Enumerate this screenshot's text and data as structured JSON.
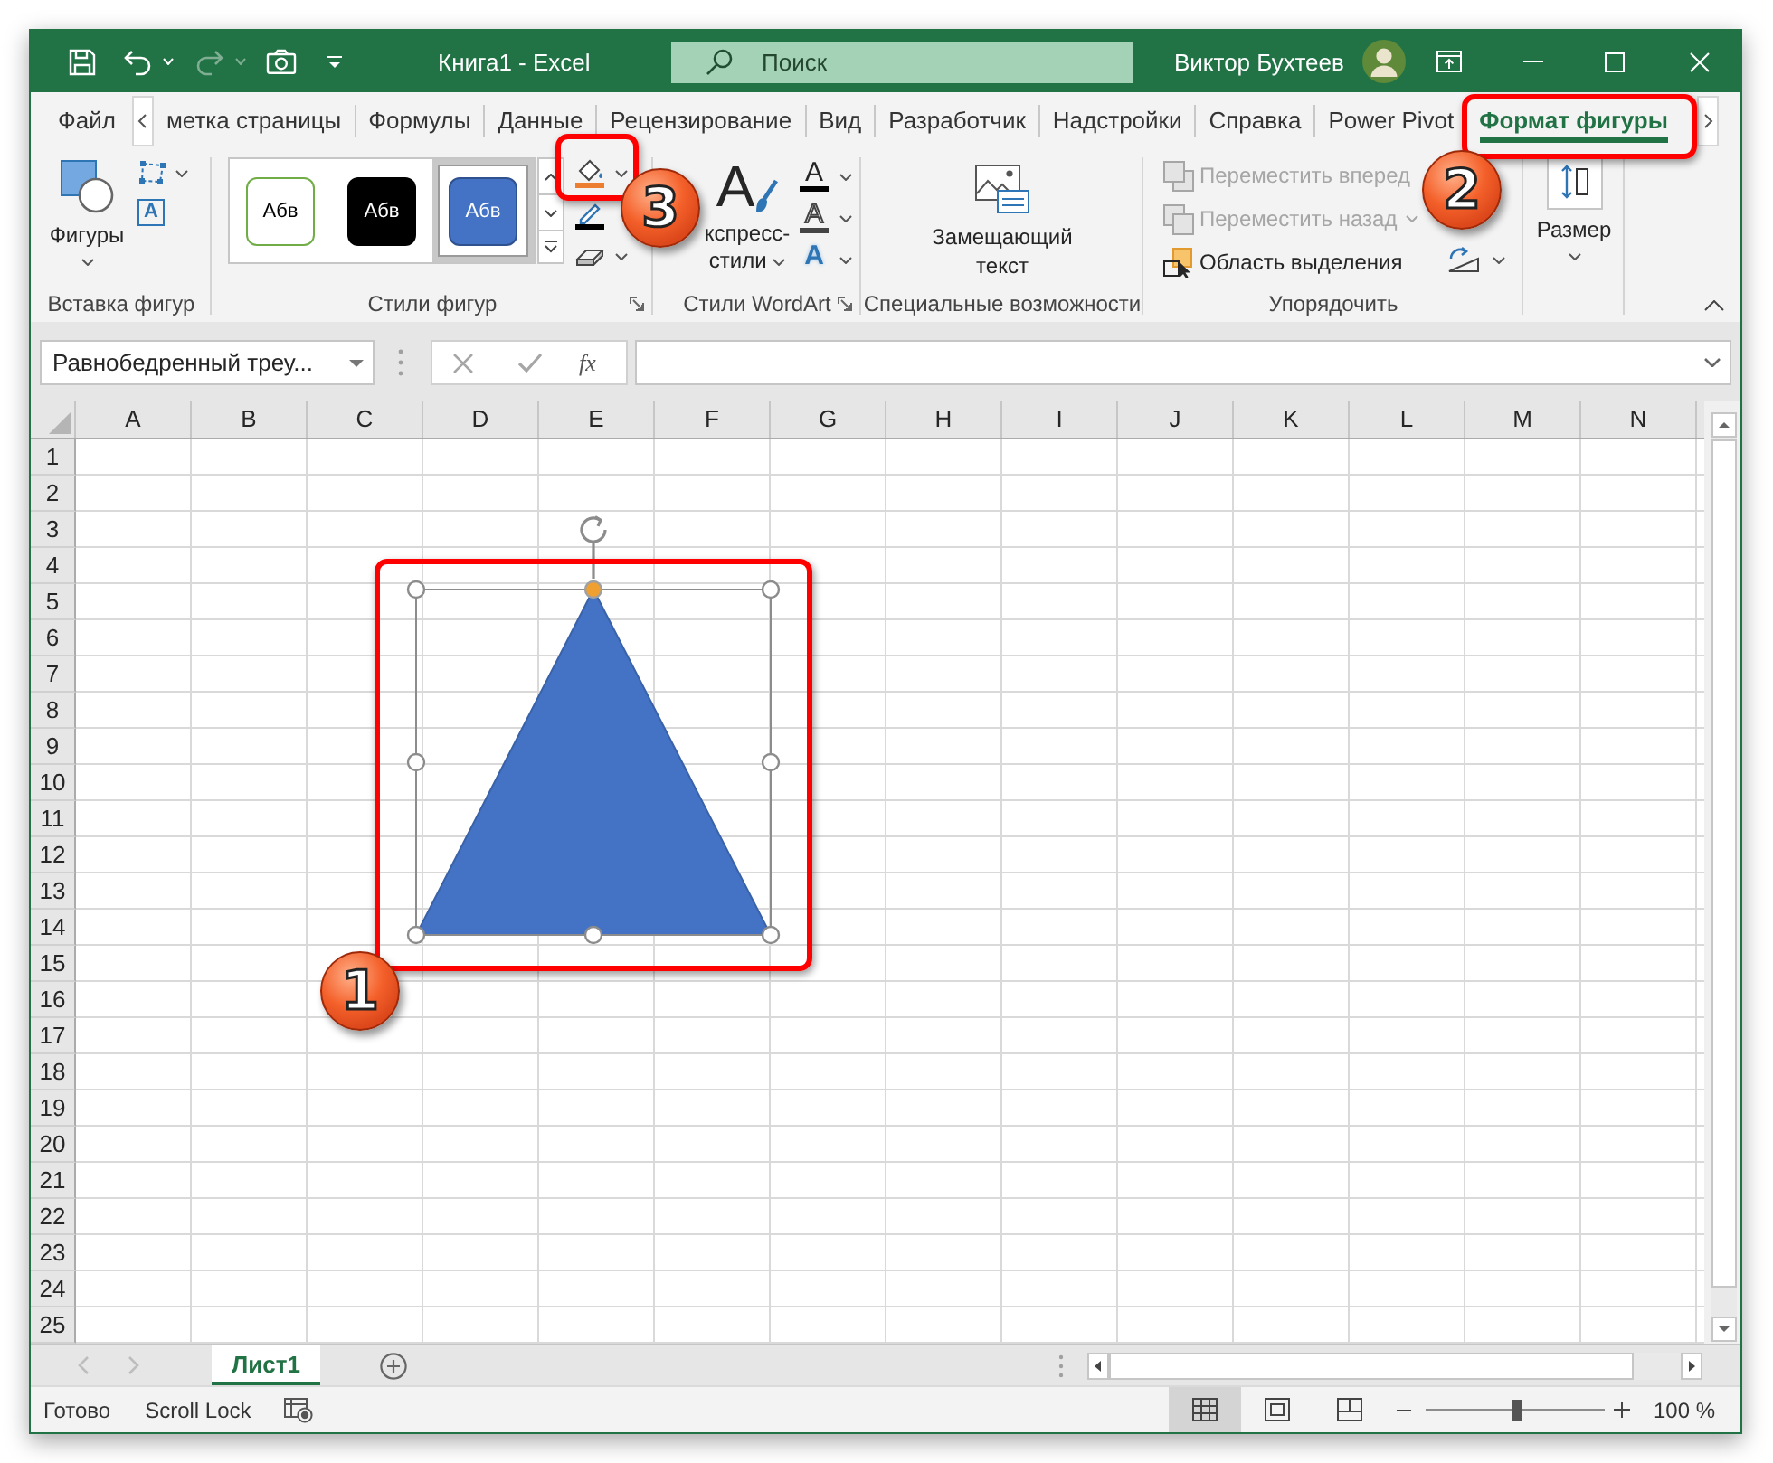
{
  "window": {
    "title": "Книга1 - Excel",
    "search_placeholder": "Поиск",
    "user": "Виктор Бухтеев"
  },
  "quick_access": [
    {
      "kind": "save",
      "disabled": false
    },
    {
      "kind": "undo",
      "disabled": false
    },
    {
      "kind": "redo",
      "disabled": true
    },
    {
      "kind": "camera",
      "disabled": false
    },
    {
      "kind": "customize",
      "disabled": false
    }
  ],
  "tabs": [
    {
      "label": "Файл",
      "selected": false
    },
    {
      "label": "метка страницы",
      "selected": false
    },
    {
      "label": "Формулы",
      "selected": false
    },
    {
      "label": "Данные",
      "selected": false
    },
    {
      "label": "Рецензирование",
      "selected": false
    },
    {
      "label": "Вид",
      "selected": false
    },
    {
      "label": "Разработчик",
      "selected": false
    },
    {
      "label": "Надстройки",
      "selected": false
    },
    {
      "label": "Справка",
      "selected": false
    },
    {
      "label": "Power Pivot",
      "selected": false
    },
    {
      "label": "Формат фигуры",
      "selected": true
    }
  ],
  "ribbon": {
    "insert_shapes": {
      "label": "Вставка фигур",
      "shapes_button": "Фигуры",
      "text_box_glyph": "A"
    },
    "shape_styles": {
      "label": "Стили фигур",
      "gallery": [
        {
          "text": "Абв",
          "kind": "outline",
          "selected": false
        },
        {
          "text": "Абв",
          "kind": "dark",
          "selected": false
        },
        {
          "text": "Абв",
          "kind": "accent",
          "selected": true
        }
      ]
    },
    "wordart_styles": {
      "label": "Стили WordArt",
      "quick_styles": "кспресс-стили",
      "quick_styles_glyph": "A",
      "text_tools": [
        {
          "kind": "fill",
          "glyph": "A"
        },
        {
          "kind": "outline",
          "glyph": "A"
        },
        {
          "kind": "effects",
          "glyph": "A"
        }
      ]
    },
    "accessibility": {
      "label": "Специальные возможности",
      "alt_text": "Замещающий текст"
    },
    "arrange": {
      "label": "Упорядочить",
      "commands": [
        {
          "kind": "bring_forward",
          "label": "Переместить вперед",
          "disabled": true,
          "dropdown": false
        },
        {
          "kind": "send_backward",
          "label": "Переместить назад",
          "disabled": true,
          "dropdown": true
        },
        {
          "kind": "selection_pane",
          "label": "Область выделения",
          "disabled": false,
          "dropdown": false
        }
      ]
    },
    "size": {
      "label": "Размер"
    }
  },
  "formula_bar": {
    "name_box": "Равнобедренный треу...",
    "function_label": "fx"
  },
  "sheet": {
    "columns": [
      "A",
      "B",
      "C",
      "D",
      "E",
      "F",
      "G",
      "H",
      "I",
      "J",
      "K",
      "L",
      "M",
      "N"
    ],
    "rows": [
      "1",
      "2",
      "3",
      "4",
      "5",
      "6",
      "7",
      "8",
      "9",
      "10",
      "11",
      "12",
      "13",
      "14",
      "15",
      "16",
      "17",
      "18",
      "19",
      "20",
      "21",
      "22",
      "23",
      "24",
      "25"
    ],
    "shape": {
      "kind": "triangle",
      "selected": true
    }
  },
  "sheet_tabs": [
    {
      "label": "Лист1",
      "selected": true
    }
  ],
  "status_bar": {
    "items": [
      "Готово",
      "Scroll Lock"
    ],
    "views": [
      {
        "kind": "normal",
        "selected": true
      },
      {
        "kind": "page_layout",
        "selected": false
      },
      {
        "kind": "page_break",
        "selected": false
      }
    ],
    "zoom": {
      "level": 0.5,
      "reading": "100 %"
    }
  },
  "callouts": [
    {
      "number": "1"
    },
    {
      "number": "2"
    },
    {
      "number": "3"
    }
  ]
}
